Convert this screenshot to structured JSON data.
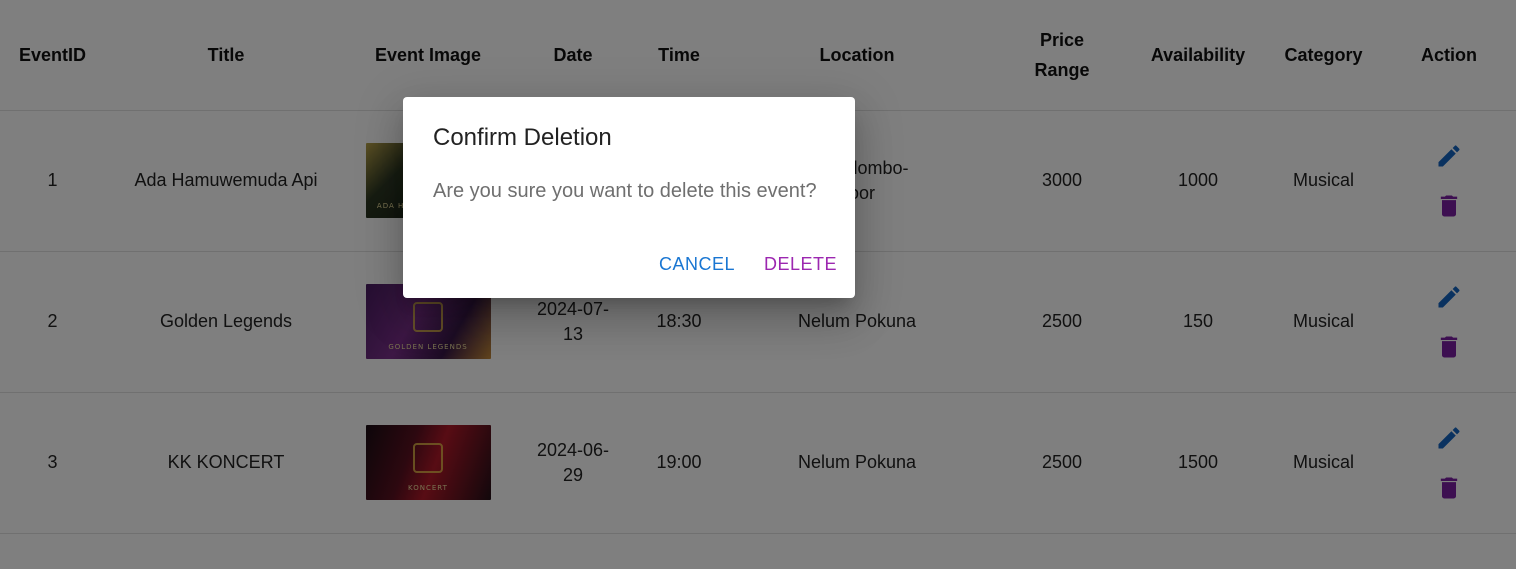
{
  "table": {
    "headers": {
      "event_id": "EventID",
      "title": "Title",
      "event_image": "Event Image",
      "date": "Date",
      "time": "Time",
      "location": "Location",
      "price_range_line1": "Price",
      "price_range_line2": "Range",
      "availability": "Availability",
      "category": "Category",
      "action": "Action"
    },
    "rows": [
      {
        "id": "1",
        "title": "Ada Hamuwemuda Api",
        "image_caption": "ADA HAMUWEMUDA API",
        "date_line1": "",
        "date_line2": "",
        "time": "",
        "location_line1": "ge Colombo-",
        "location_line2": "door",
        "price": "3000",
        "availability": "1000",
        "category": "Musical"
      },
      {
        "id": "2",
        "title": "Golden Legends",
        "image_caption": "GOLDEN LEGENDS",
        "date_line1": "2024-07-",
        "date_line2": "13",
        "time": "18:30",
        "location_line1": "Nelum Pokuna",
        "location_line2": "",
        "price": "2500",
        "availability": "150",
        "category": "Musical"
      },
      {
        "id": "3",
        "title": "KK KONCERT",
        "image_caption": "KONCERT",
        "date_line1": "2024-06-",
        "date_line2": "29",
        "time": "19:00",
        "location_line1": "Nelum Pokuna",
        "location_line2": "",
        "price": "2500",
        "availability": "1500",
        "category": "Musical"
      }
    ],
    "action_icons": {
      "edit": "edit-pencil-icon",
      "delete": "trash-can-icon"
    }
  },
  "dialog": {
    "title": "Confirm Deletion",
    "message": "Are you sure you want to delete this event?",
    "cancel_label": "CANCEL",
    "delete_label": "DELETE"
  },
  "colors": {
    "edit_icon": "#1565c0",
    "delete_icon": "#7b1fa2",
    "cancel_button": "#1976d2",
    "delete_button": "#9c27b0",
    "overlay": "rgba(0,0,0,0.5)"
  }
}
